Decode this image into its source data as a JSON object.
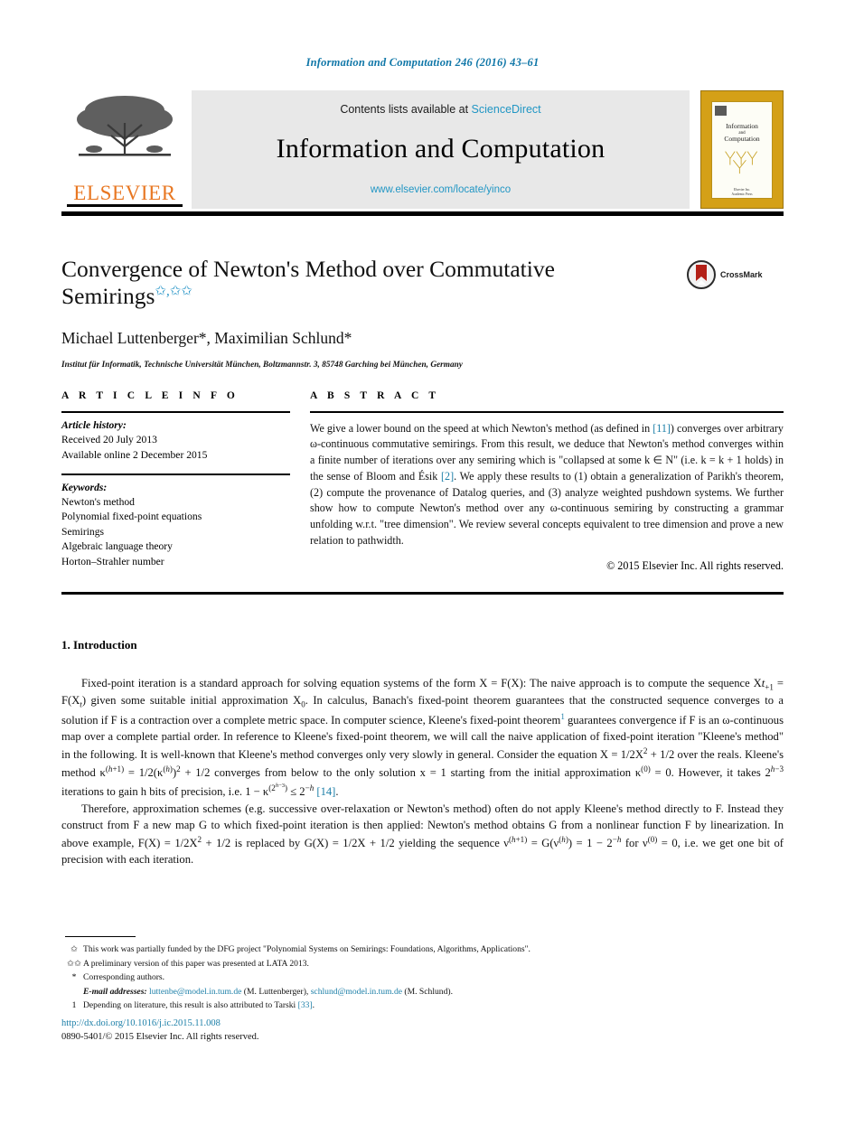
{
  "running_head": "Information and Computation 246 (2016) 43–61",
  "masthead": {
    "publisher_name": "ELSEVIER",
    "contents_prefix": "Contents lists available at",
    "contents_link": "ScienceDirect",
    "journal_name": "Information and Computation",
    "journal_url": "www.elsevier.com/locate/yinco",
    "cover": {
      "title_line1": "Information",
      "title_connector": "and",
      "title_line2": "Computation",
      "footer_line1": "Elsevier Inc.",
      "footer_line2": "Academic Press"
    }
  },
  "article": {
    "title": "Convergence of Newton's Method over Commutative Semirings",
    "title_marks": "✩,✩✩",
    "authors": "Michael Luttenberger*, Maximilian Schlund*",
    "affiliation": "Institut für Informatik, Technische Universität München, Boltzmannstr. 3, 85748 Garching bei München, Germany",
    "crossmark_label": "CrossMark"
  },
  "info": {
    "heading": "A R T I C L E   I N F O",
    "history_label": "Article history:",
    "history": [
      "Received 20 July 2013",
      "Available online 2 December 2015"
    ],
    "keywords_label": "Keywords:",
    "keywords": [
      "Newton's method",
      "Polynomial fixed-point equations",
      "Semirings",
      "Algebraic language theory",
      "Horton–Strahler number"
    ]
  },
  "abstract": {
    "heading": "A B S T R A C T",
    "paragraph_1": "We give a lower bound on the speed at which Newton's method (as defined in ",
    "ref_11": "[11]",
    "paragraph_2": ") converges over arbitrary ω-continuous commutative semirings. From this result, we deduce that Newton's method converges within a finite number of iterations over any semiring which is \"collapsed at some k ∈ N\" (i.e. k = k + 1 holds) in the sense of Bloom and Ésik ",
    "ref_2": "[2]",
    "paragraph_3": ". We apply these results to (1) obtain a generalization of Parikh's theorem, (2) compute the provenance of Datalog queries, and (3) analyze weighted pushdown systems. We further show how to compute Newton's method over any ω-continuous semiring by constructing a grammar unfolding w.r.t. \"tree dimension\". We review several concepts equivalent to tree dimension and prove a new relation to pathwidth.",
    "copyright": "© 2015 Elsevier Inc. All rights reserved."
  },
  "body": {
    "section_number_title": "1. Introduction",
    "para1_a": "Fixed-point iteration is a standard approach for solving equation systems of the form X = F(X): The naive approach is to compute the sequence X",
    "para1_b": " = F(X",
    "para1_c": ") given some suitable initial approximation X",
    "para1_d": ". In calculus, Banach's fixed-point theorem guarantees that the constructed sequence converges to a solution if F is a contraction over a complete metric space. In computer science, Kleene's fixed-point theorem",
    "para1_e": " guarantees convergence if F is an ω-continuous map over a complete partial order. In reference to Kleene's fixed-point theorem, we will call the naive application of fixed-point iteration \"Kleene's method\" in the following. It is well-known that Kleene's method converges only very slowly in general. Consider the equation X = 1/2X",
    "para1_f": " + 1/2 over the reals. Kleene's method κ",
    "para1_g": " = 1/2(κ",
    "para1_h": ")",
    "para1_i": " + 1/2 converges from below to the only solution x = 1 starting from the initial approximation κ",
    "para1_j": " = 0. However, it takes 2",
    "para1_k": " iterations to gain h bits of precision, i.e. 1 − κ",
    "para1_l": " ≤ 2",
    "ref_14": "[14]",
    "para2_a": "Therefore, approximation schemes (e.g. successive over-relaxation or Newton's method) often do not apply Kleene's method directly to F. Instead they construct from F a new map G to which fixed-point iteration is then applied: Newton's method obtains G from a nonlinear function F by linearization. In above example, F(X) = 1/2X",
    "para2_b": " + 1/2 is replaced by G(X) = 1/2X + 1/2 yielding the sequence ν",
    "para2_c": " = G(ν",
    "para2_d": ") = 1 − 2",
    "para2_e": " for ν",
    "para2_f": " = 0, i.e. we get one bit of precision with each iteration."
  },
  "footnotes": [
    {
      "symbol": "✩",
      "text": "This work was partially funded by the DFG project \"Polynomial Systems on Semirings: Foundations, Algorithms, Applications\"."
    },
    {
      "symbol": "✩✩",
      "text": "A preliminary version of this paper was presented at LATA 2013."
    },
    {
      "symbol": "*",
      "text": "Corresponding authors."
    },
    {
      "symbol": "1",
      "text": "Depending on literature, this result is also attributed to Tarski "
    }
  ],
  "email_line": {
    "label": "E-mail addresses:",
    "email1": "luttenbe@model.in.tum.de",
    "author1": "(M. Luttenberger),",
    "email2": "schlund@model.in.tum.de",
    "author2": "(M. Schlund)."
  },
  "footnote_ref_33": "[33]",
  "doi": "http://dx.doi.org/10.1016/j.ic.2015.11.008",
  "issn_line": "0890-5401/© 2015 Elsevier Inc. All rights reserved.",
  "colors": {
    "link_blue": "#1c7fa8",
    "science_direct_blue": "#2196c4",
    "elsevier_orange": "#E87722",
    "cover_gold": "#d4a017",
    "crossmark_red": "#b32017"
  }
}
